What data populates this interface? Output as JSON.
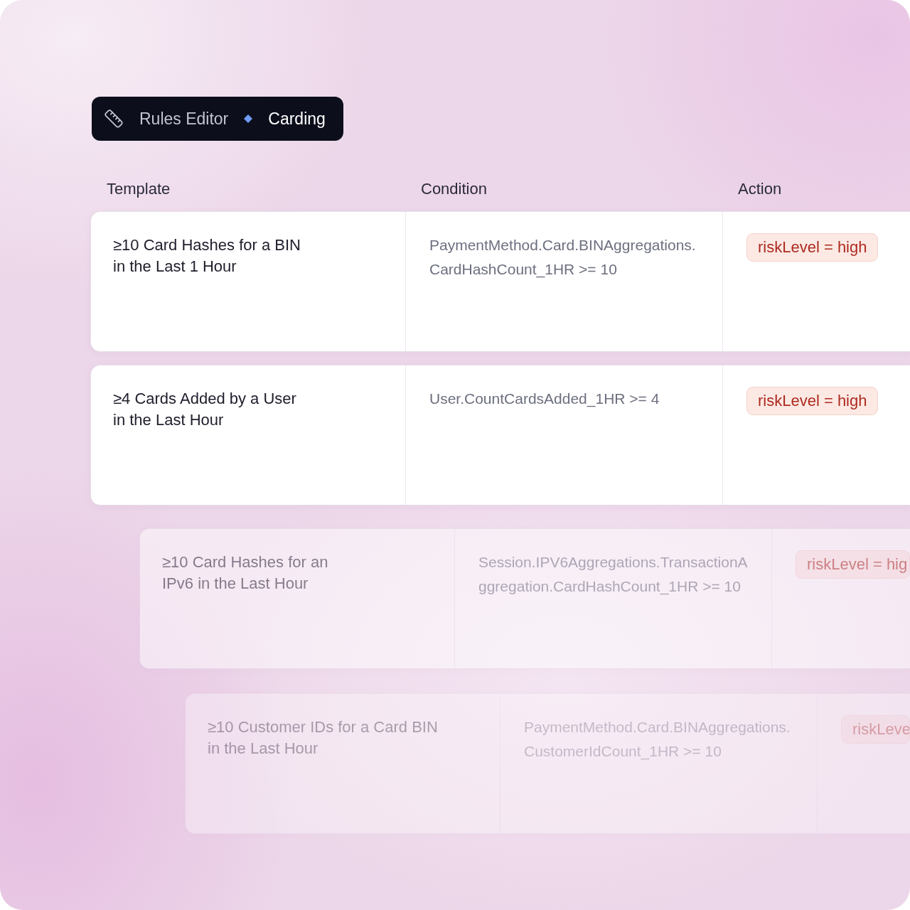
{
  "breadcrumb": {
    "items": [
      {
        "label": "Rules Editor",
        "selected": false
      },
      {
        "label": "Carding",
        "selected": true
      }
    ]
  },
  "table": {
    "columns": [
      "Template",
      "Condition",
      "Action"
    ],
    "rows": [
      {
        "template": "≥10 Card Hashes for a BIN\nin the Last 1 Hour",
        "condition": "PaymentMethod.Card.BINAggregations.CardHashCount_1HR >= 10",
        "action": "riskLevel = high"
      },
      {
        "template": "≥4 Cards Added by a User\nin the Last Hour",
        "condition": "User.CountCardsAdded_1HR >= 4",
        "action": "riskLevel = high"
      },
      {
        "template": "≥10 Card Hashes for an\nIPv6 in the Last Hour",
        "condition": "Session.IPV6Aggregations.TransactionAggregation.CardHashCount_1HR >= 10",
        "action": "riskLevel = hig"
      },
      {
        "template": "≥10 Customer IDs for a Card BIN\nin the Last Hour",
        "condition": "PaymentMethod.Card.BINAggregations.CustomerIdCount_1HR >= 10",
        "action": "riskLeve"
      }
    ]
  }
}
